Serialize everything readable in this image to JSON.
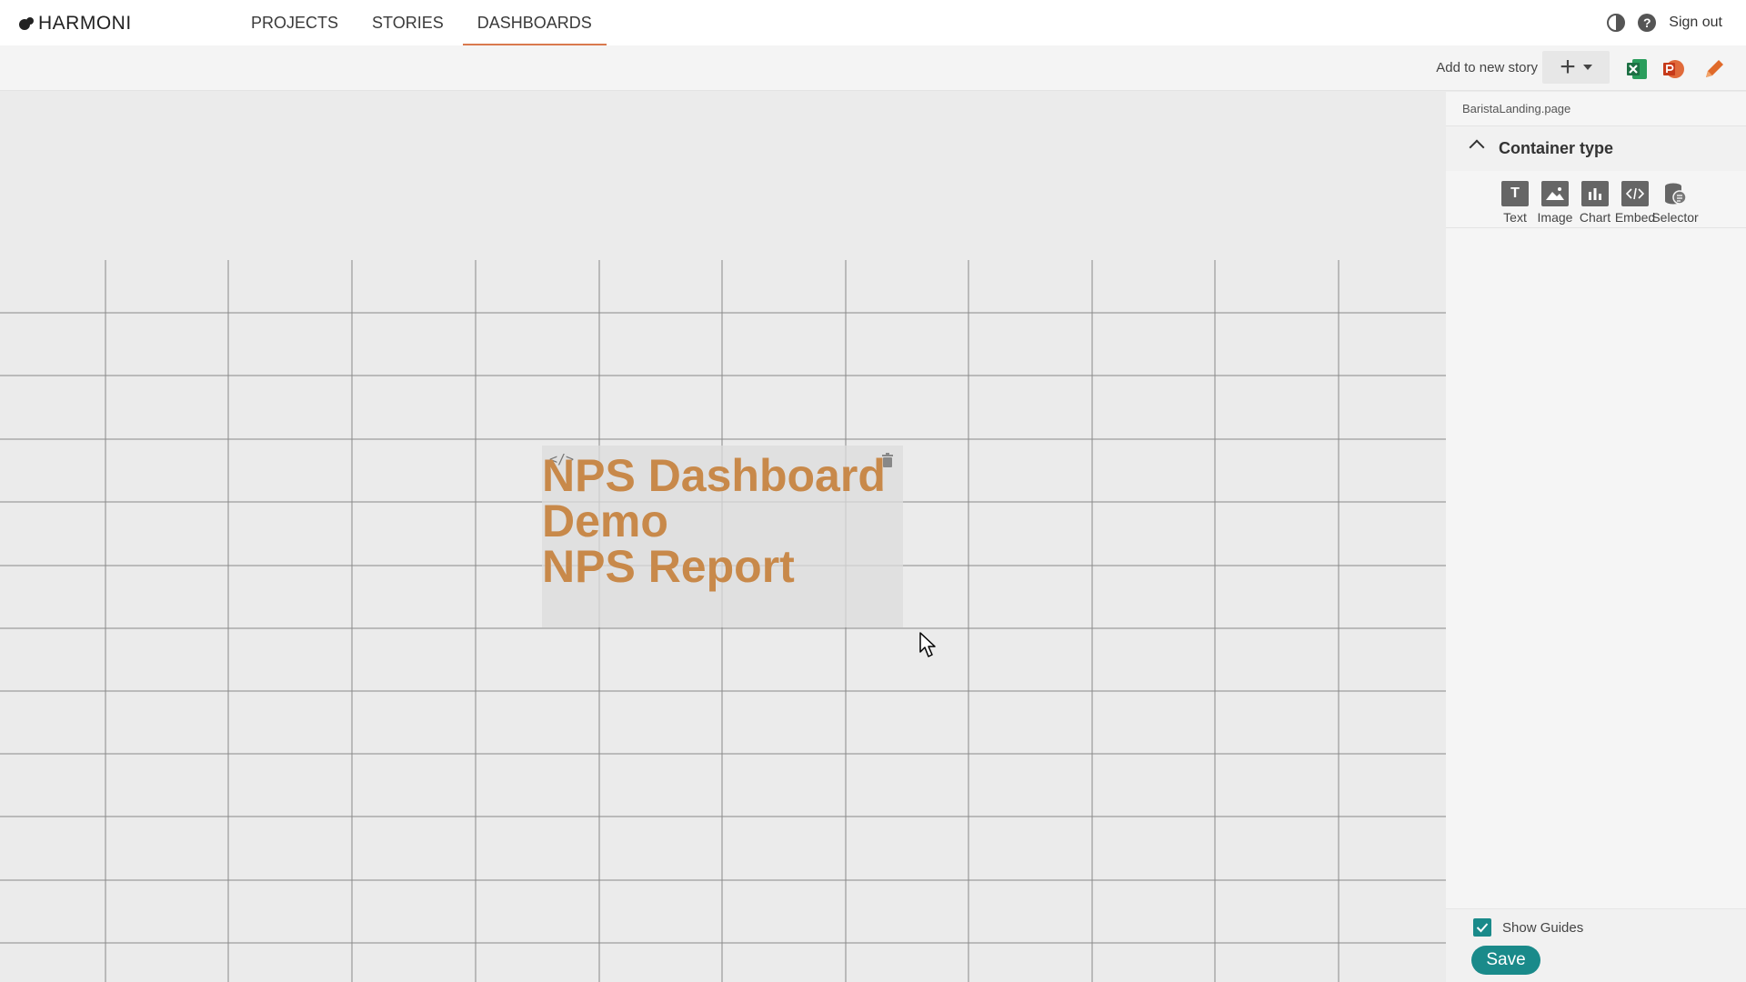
{
  "app": {
    "name": "HARMONI"
  },
  "nav": {
    "tabs": [
      {
        "label": "PROJECTS"
      },
      {
        "label": "STORIES"
      },
      {
        "label": "DASHBOARDS"
      }
    ],
    "active_tab": "DASHBOARDS",
    "sign_out": "Sign out",
    "help_glyph": "?"
  },
  "toolbar": {
    "add_to_story": "Add to new story",
    "plus_glyph": "+"
  },
  "canvas": {
    "container": {
      "code_glyph": "</>",
      "lines": [
        "NPS Dashboard",
        "Demo",
        "NPS Report"
      ]
    }
  },
  "panel": {
    "page_name": "BaristaLanding.page",
    "section_title": "Container type",
    "types": [
      {
        "label": "Text",
        "icon": "text-icon",
        "glyph": "T"
      },
      {
        "label": "Image",
        "icon": "image-icon"
      },
      {
        "label": "Chart",
        "icon": "chart-icon"
      },
      {
        "label": "Embed",
        "icon": "embed-icon"
      },
      {
        "label": "Selector",
        "icon": "selector-icon"
      }
    ],
    "show_guides": {
      "label": "Show Guides",
      "checked": true
    },
    "save": "Save"
  },
  "colors": {
    "accent": "#d9794e",
    "teal": "#1a8a8a",
    "title_text": "#c8894a",
    "excel": "#1d7044",
    "powerpoint": "#d04423",
    "pencil": "#e06a2a"
  }
}
